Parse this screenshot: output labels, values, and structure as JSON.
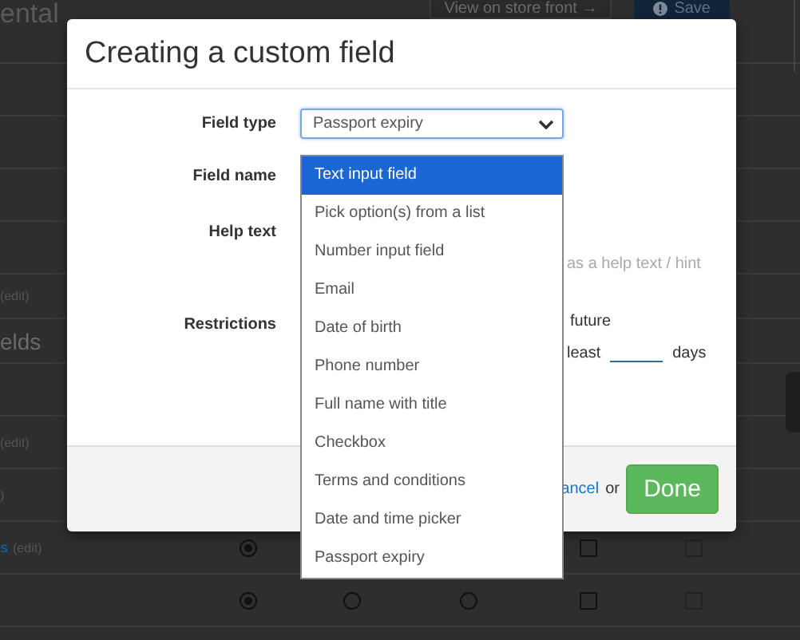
{
  "page": {
    "title": "ental",
    "store_link": "View on store front →",
    "save_button": "Save",
    "rows": [
      {
        "kind": "blank"
      },
      {
        "kind": "blank"
      },
      {
        "kind": "blank"
      },
      {
        "kind": "blank"
      },
      {
        "kind": "edit",
        "text": "(edit)"
      },
      {
        "kind": "section",
        "text": "elds"
      },
      {
        "kind": "blank"
      },
      {
        "kind": "edit",
        "text": "(edit)"
      },
      {
        "kind": "edit",
        "text": ")"
      },
      {
        "kind": "link",
        "text": "s",
        "edit": "(edit)",
        "controls": [
          {
            "kind": "radio",
            "selected": true
          },
          {
            "kind": "hidden"
          },
          {
            "kind": "hidden"
          },
          {
            "kind": "checkbox",
            "checked": false
          },
          {
            "kind": "checkbox",
            "checked": false
          }
        ]
      },
      {
        "kind": "blank",
        "controls": [
          {
            "kind": "radio",
            "selected": true
          },
          {
            "kind": "radio",
            "selected": false
          },
          {
            "kind": "radio",
            "selected": false
          },
          {
            "kind": "checkbox",
            "checked": false
          },
          {
            "kind": "checkbox",
            "checked": false
          }
        ]
      }
    ]
  },
  "dialog": {
    "title": "Creating a custom field",
    "fields": [
      {
        "label": "Field type"
      },
      {
        "label": "Field name"
      },
      {
        "label": "Help text",
        "note": "as a help text / hint"
      },
      {
        "label": "Restrictions",
        "lines": [
          "future"
        ],
        "least": "least",
        "days": "days"
      }
    ],
    "select": {
      "value": "Passport expiry",
      "expanded": true,
      "options": [
        {
          "label": "Text input field",
          "highlighted": true
        },
        {
          "label": "Pick option(s) from a list",
          "highlighted": false
        },
        {
          "label": "Number input field",
          "highlighted": false
        },
        {
          "label": "Email",
          "highlighted": false
        },
        {
          "label": "Date of birth",
          "highlighted": false
        },
        {
          "label": "Phone number",
          "highlighted": false
        },
        {
          "label": "Full name with title",
          "highlighted": false
        },
        {
          "label": "Checkbox",
          "highlighted": false
        },
        {
          "label": "Terms and conditions",
          "highlighted": false
        },
        {
          "label": "Date and time picker",
          "highlighted": false
        },
        {
          "label": "Passport expiry",
          "highlighted": false
        }
      ]
    },
    "cancel_link": "ancel",
    "or": "or",
    "done_button": "Done"
  }
}
